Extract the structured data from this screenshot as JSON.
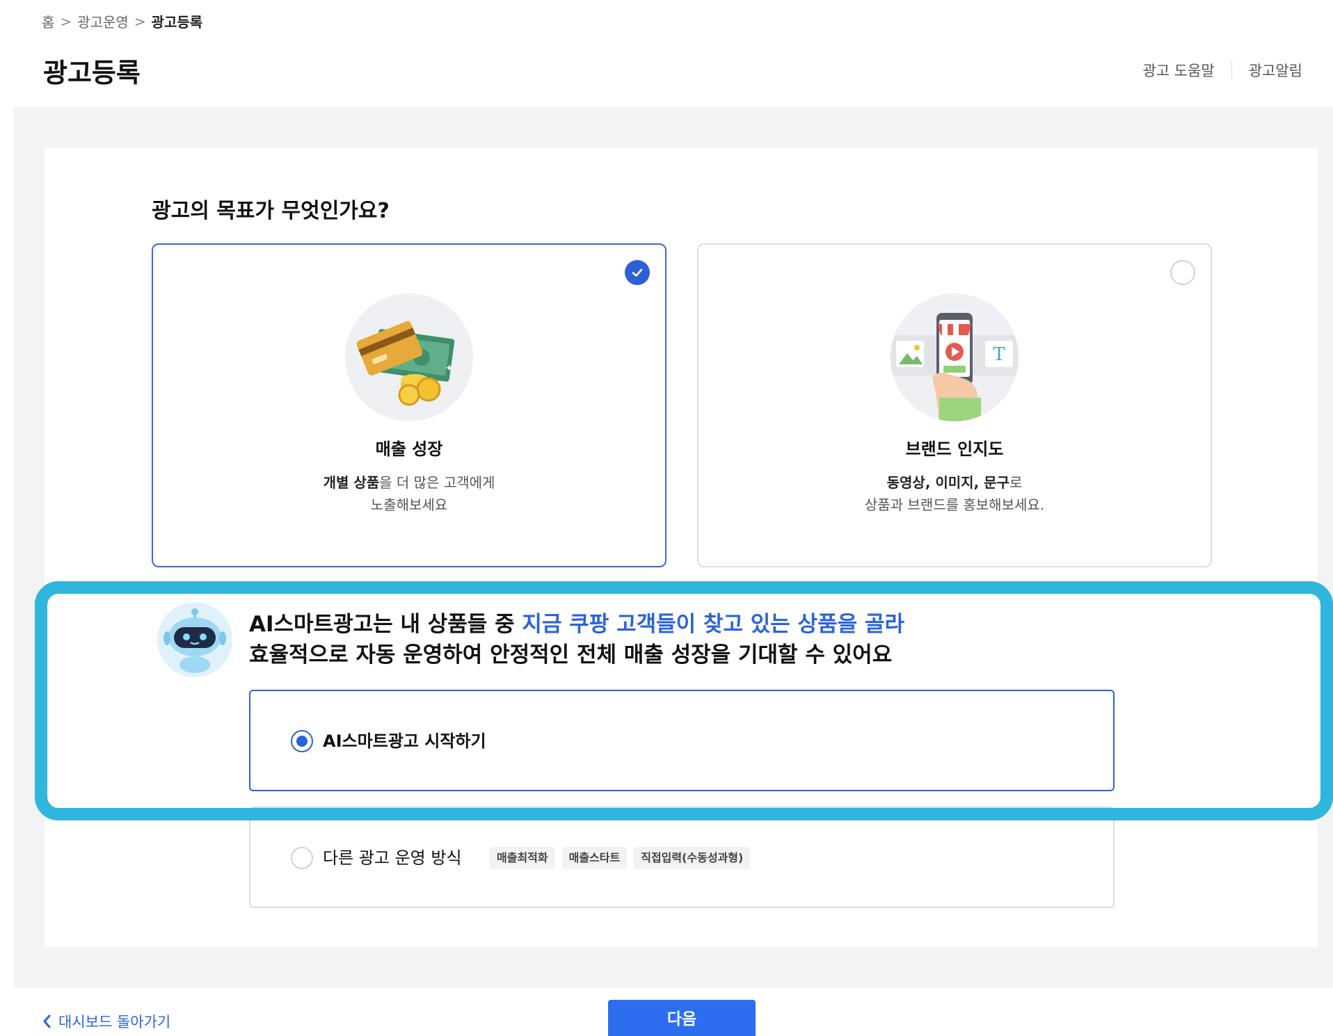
{
  "breadcrumb": {
    "home": "홈",
    "section": "광고운영",
    "current": "광고등록",
    "separator": ">"
  },
  "page_title": "광고등록",
  "top_links": {
    "help": "광고 도움말",
    "alerts": "광고알림"
  },
  "question": "광고의 목표가 무엇인가요?",
  "goals": [
    {
      "title": "매출 성장",
      "desc_bold": "개별 상품",
      "desc_rest": "을 더 많은 고객에게",
      "desc_line2": "노출해보세요",
      "selected": true,
      "icon": "money-card-icon"
    },
    {
      "title": "브랜드 인지도",
      "desc_bold": "동영상, 이미지, 문구",
      "desc_rest": "로",
      "desc_line2": "상품과 브랜드를 홍보해보세요.",
      "selected": false,
      "icon": "phone-store-icon"
    }
  ],
  "ai_banner": {
    "line1_prefix": "AI스마트광고는 내 상품들 중 ",
    "line1_highlight": "지금 쿠팡 고객들이 찾고 있는 상품을 골라",
    "line2": "효율적으로 자동 운영하여 안정적인 전체 매출 성장을 기대할 수 있어요",
    "highlight_color": "#2a63db",
    "frame_color": "#2fb6dd"
  },
  "options": {
    "ai_start": {
      "label": "AI스마트광고 시작하기",
      "selected": true
    },
    "other": {
      "label": "다른 광고 운영 방식",
      "selected": false,
      "tags": [
        "매출최적화",
        "매출스타트",
        "직접입력(수동성과형)"
      ]
    }
  },
  "footer": {
    "back_label": "대시보드 돌아가기",
    "next_label": "다음",
    "accent": "#2d6ef0"
  }
}
